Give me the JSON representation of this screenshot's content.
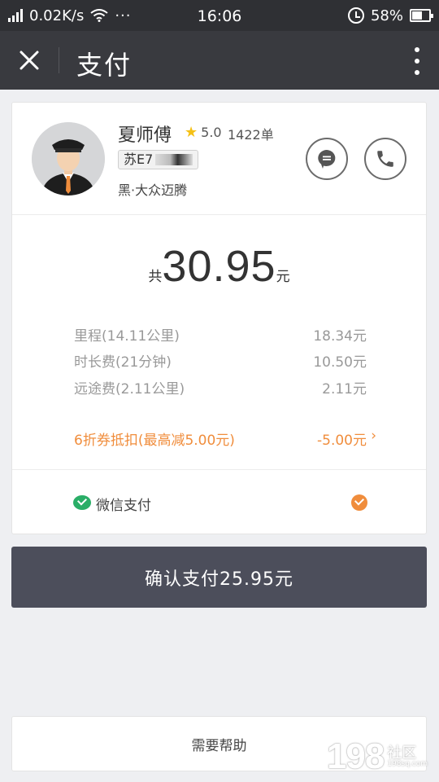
{
  "status_bar": {
    "speed": "0.02K/s",
    "dots": "···",
    "time": "16:06",
    "battery": "58%",
    "battery_level": 0.58
  },
  "header": {
    "title": "支付",
    "close_icon": "close-icon",
    "more_icon": "more-vertical-icon"
  },
  "driver": {
    "name": "夏师傅",
    "rating": "5.0",
    "orders": "1422单",
    "plate": "苏E7",
    "car": "黑·大众迈腾"
  },
  "fare": {
    "prefix": "共",
    "amount": "30.95",
    "unit": "元",
    "items": [
      {
        "label": "里程(14.11公里)",
        "value": "18.34元"
      },
      {
        "label": "时长费(21分钟)",
        "value": "10.50元"
      },
      {
        "label": "远途费(2.11公里)",
        "value": "2.11元"
      }
    ],
    "discount": {
      "label": "6折券抵扣(最高减5.00元)",
      "value": "-5.00元",
      "chevron": "›"
    }
  },
  "payment": {
    "method": "微信支付",
    "confirm_label": "确认支付25.95元"
  },
  "help": {
    "label": "需要帮助"
  },
  "watermark": {
    "number": "198",
    "text": "社区",
    "domain": "198sq.com"
  },
  "colors": {
    "accent": "#f08d3c",
    "wechat": "#2aae67",
    "confirm_bg": "#4c4e5b",
    "header_bg": "#393a3f"
  }
}
